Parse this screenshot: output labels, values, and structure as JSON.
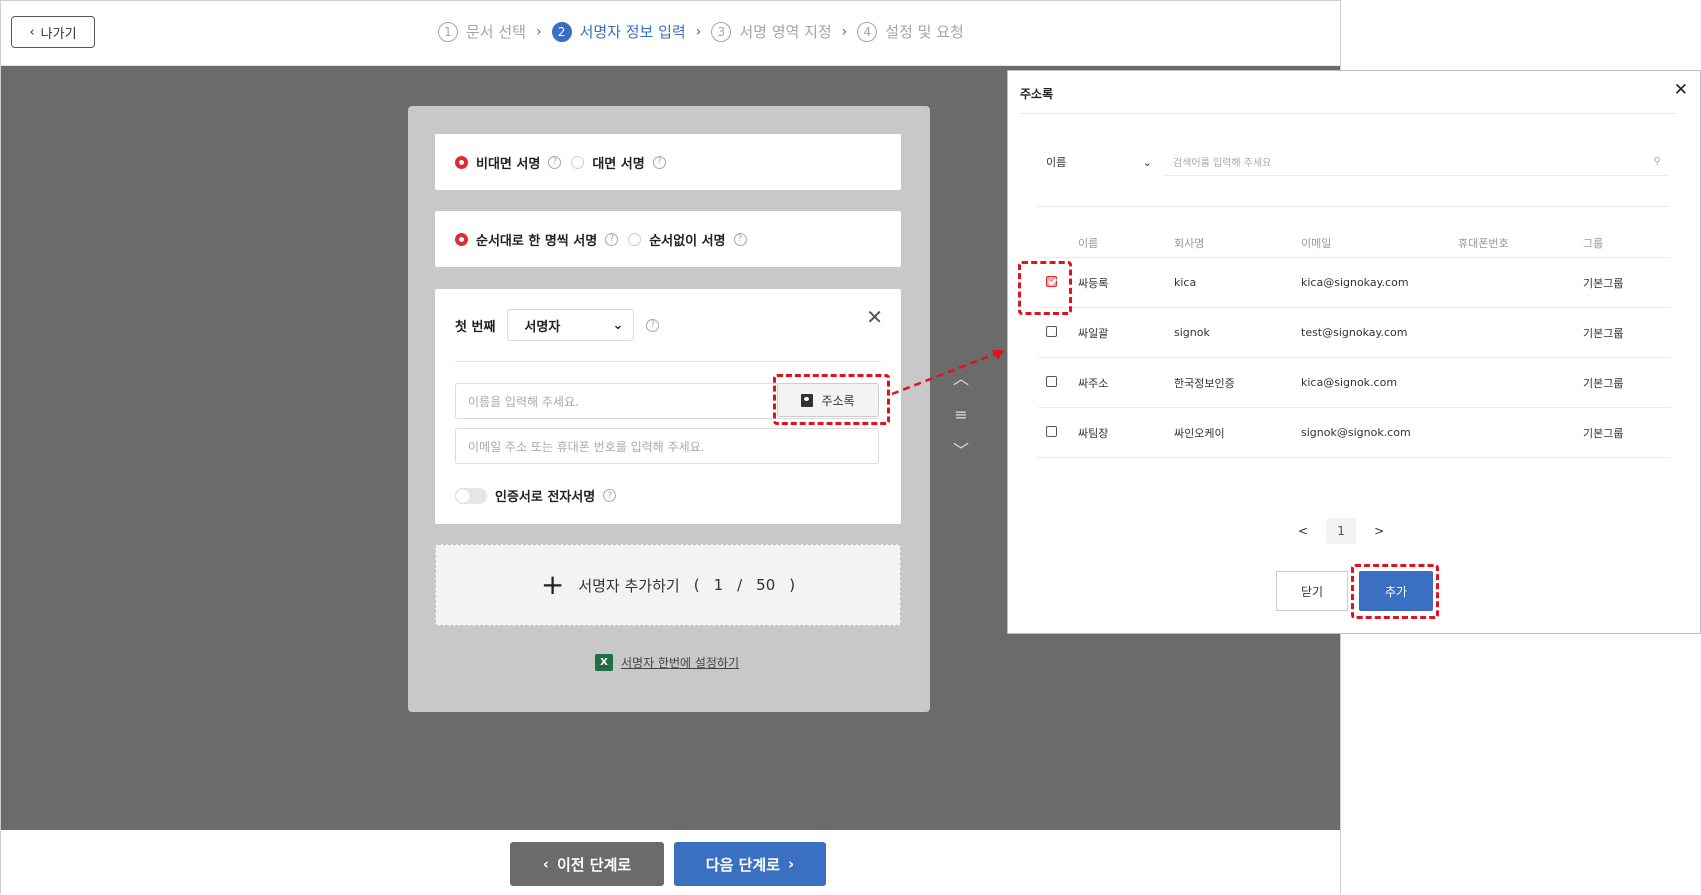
{
  "header": {
    "back_label": "나가기",
    "steps": [
      {
        "num": "1",
        "label": "문서 선택"
      },
      {
        "num": "2",
        "label": "서명자 정보 입력"
      },
      {
        "num": "3",
        "label": "서명 영역 지정"
      },
      {
        "num": "4",
        "label": "설정 및 요청"
      }
    ],
    "active_step": 2
  },
  "form": {
    "sign_type": {
      "option_a": "비대면 서명",
      "option_b": "대면 서명",
      "selected": "비대면 서명"
    },
    "order_type": {
      "option_a": "순서대로 한 명씩 서명",
      "option_b": "순서없이 서명",
      "selected": "순서대로 한 명씩 서명"
    },
    "signer": {
      "order_label": "첫 번째",
      "role": "서명자",
      "name_placeholder": "이름을 입력해 주세요.",
      "address_book_label": "주소록",
      "contact_placeholder": "이메일 주소 또는 휴대폰 번호를 입력해 주세요.",
      "cert_toggle_label": "인증서로 전자서명"
    },
    "add_signer": {
      "label": "서명자 추가하기",
      "open": "(",
      "current": "1",
      "slash": "/",
      "max": "50",
      "close": ")"
    },
    "bulk_link": "서명자 한번에 설정하기",
    "excel_icon_text": "X"
  },
  "footer": {
    "prev_label": "이전 단계로",
    "next_label": "다음 단계로"
  },
  "modal": {
    "title": "주소록",
    "search_field": "이름",
    "search_placeholder": "검색어를 입력해 주세요",
    "columns": [
      "이름",
      "회사명",
      "이메일",
      "휴대폰번호",
      "그룹"
    ],
    "rows": [
      {
        "checked": true,
        "name": "싸등록",
        "company": "kica",
        "email": "kica@signokay.com",
        "phone": "",
        "group": "기본그룹"
      },
      {
        "checked": false,
        "name": "싸일괄",
        "company": "signok",
        "email": "test@signokay.com",
        "phone": "",
        "group": "기본그룹"
      },
      {
        "checked": false,
        "name": "싸주소",
        "company": "한국정보인증",
        "email": "kica@signok.com",
        "phone": "",
        "group": "기본그룹"
      },
      {
        "checked": false,
        "name": "싸팀장",
        "company": "싸인오케이",
        "email": "signok@signok.com",
        "phone": "",
        "group": "기본그룹"
      }
    ],
    "pager": {
      "prev": "<",
      "page": "1",
      "next": ">"
    },
    "close_label": "닫기",
    "add_label": "추가"
  },
  "colors": {
    "accent": "#3a6fc2",
    "highlight": "#e0121f",
    "radio_on": "#e02b36",
    "overlay": "#6b6b6b"
  }
}
